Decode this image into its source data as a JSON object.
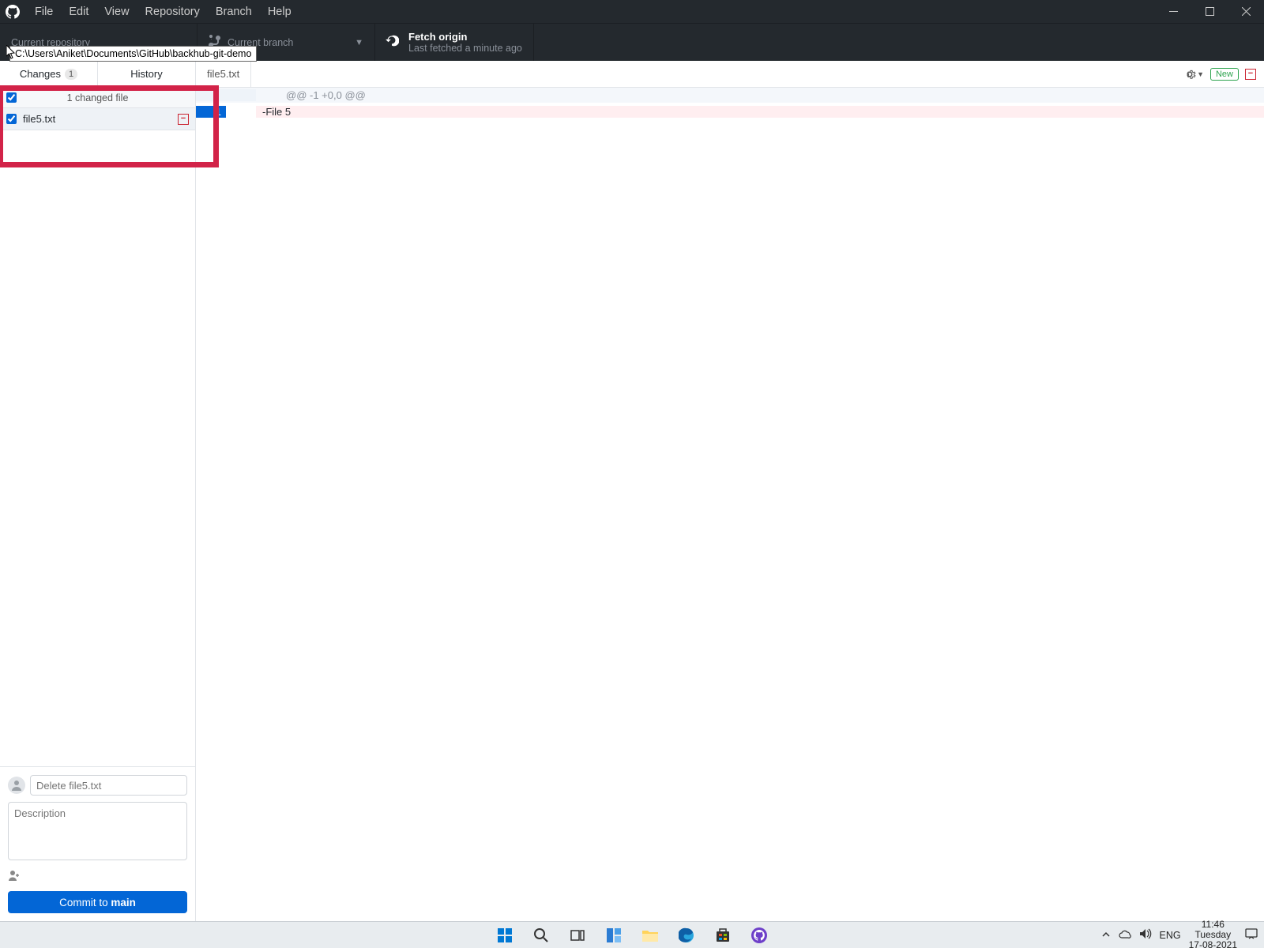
{
  "menu": {
    "file": "File",
    "edit": "Edit",
    "view": "View",
    "repository": "Repository",
    "branch": "Branch",
    "help": "Help"
  },
  "toolbar": {
    "repo_label": "Current repository",
    "repo_tooltip": "C:\\Users\\Aniket\\Documents\\GitHub\\backhub-git-demo",
    "branch_label": "Current branch",
    "fetch_title": "Fetch origin",
    "fetch_subtitle": "Last fetched a minute ago"
  },
  "tabs": {
    "changes": "Changes",
    "changes_count": "1",
    "history": "History",
    "file_tab": "file5.txt",
    "new_pill": "New"
  },
  "sidebar": {
    "header": "1 changed file",
    "file": "file5.txt"
  },
  "commit": {
    "summary_placeholder": "Delete file5.txt",
    "desc_placeholder": "Description",
    "button_prefix": "Commit to ",
    "button_branch": "main"
  },
  "diff": {
    "hunk": "@@ -1 +0,0 @@",
    "line_no": "1",
    "removed": "-File 5"
  },
  "tray": {
    "lang": "ENG",
    "time": "11:46",
    "day": "Tuesday",
    "date": "17-08-2021"
  }
}
